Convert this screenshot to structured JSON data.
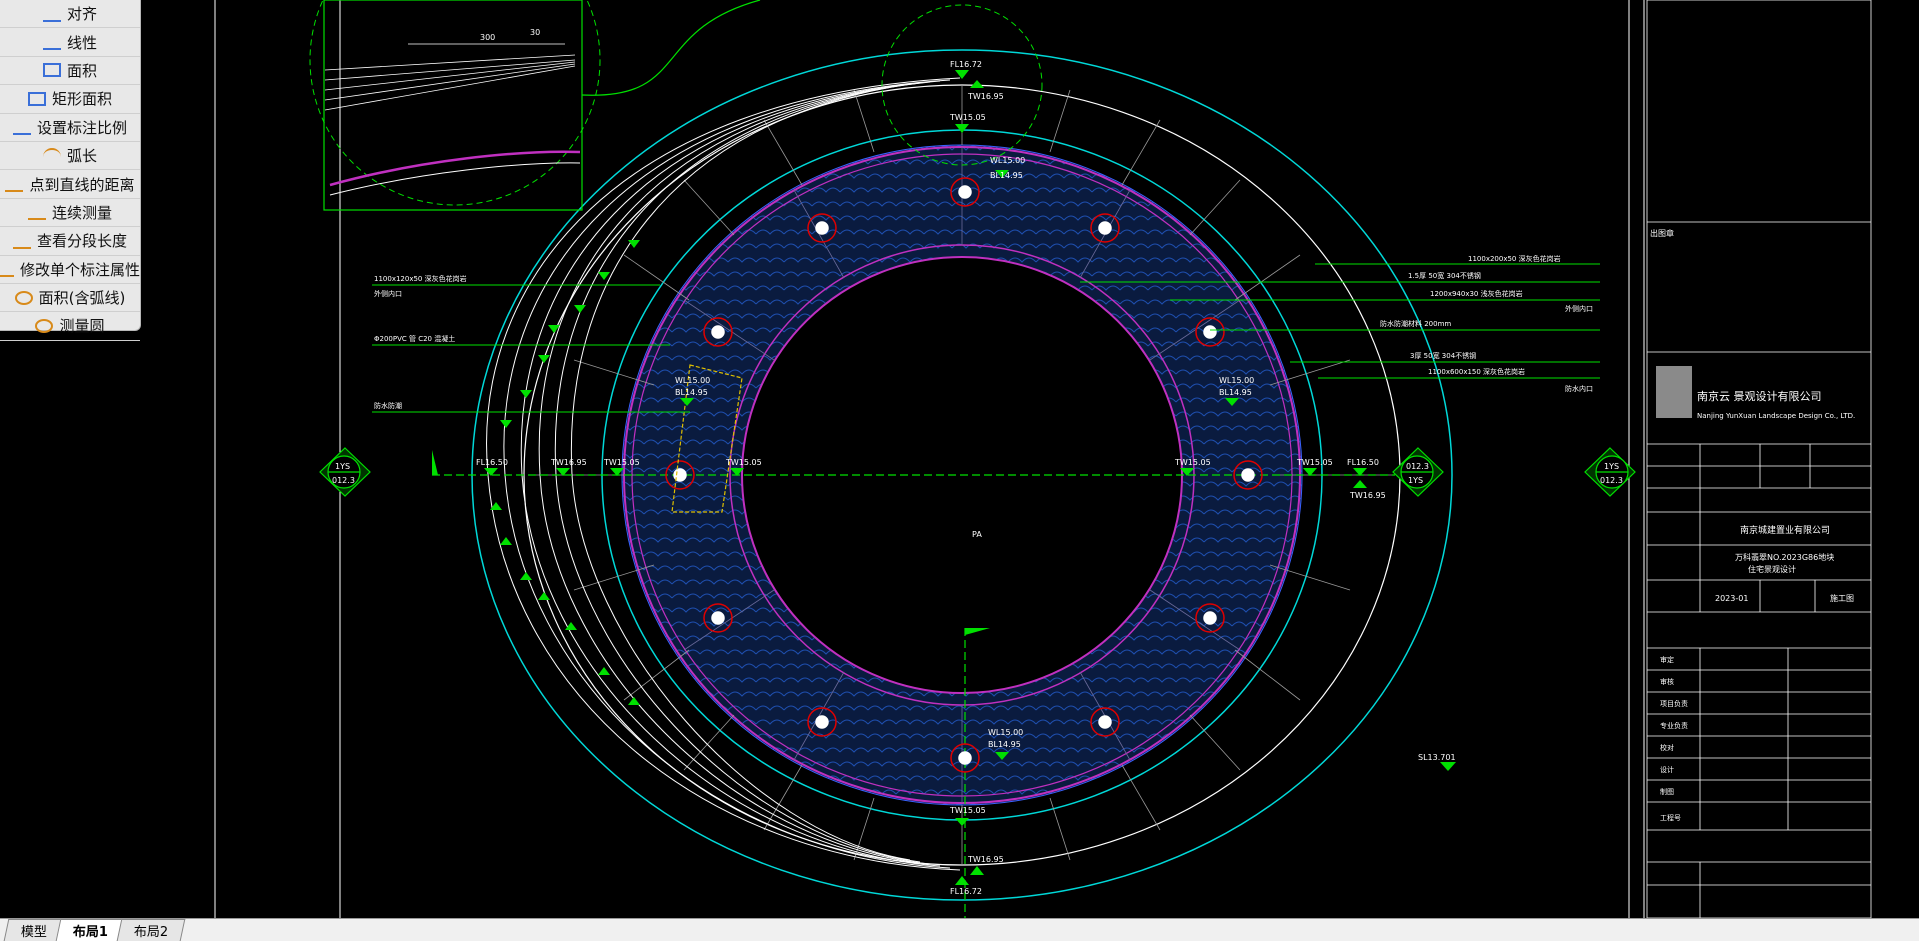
{
  "toolbar": {
    "items": [
      {
        "label": "对齐",
        "icon": "align-icon"
      },
      {
        "label": "线性",
        "icon": "linear-dimension-icon"
      },
      {
        "label": "面积",
        "icon": "area-icon"
      },
      {
        "label": "矩形面积",
        "icon": "rect-area-icon"
      },
      {
        "label": "设置标注比例",
        "icon": "scale-icon"
      },
      {
        "label": "弧长",
        "icon": "arc-length-icon"
      },
      {
        "label": "点到直线的距离",
        "icon": "point-line-distance-icon"
      },
      {
        "label": "连续测量",
        "icon": "continuous-measure-icon"
      },
      {
        "label": "查看分段长度",
        "icon": "segment-length-icon"
      },
      {
        "label": "修改单个标注属性",
        "icon": "edit-annotation-icon"
      },
      {
        "label": "面积(含弧线)",
        "icon": "arc-area-icon"
      },
      {
        "label": "测量圆",
        "icon": "measure-circle-icon"
      }
    ]
  },
  "tabs": [
    {
      "label": "模型",
      "active": false
    },
    {
      "label": "布局1",
      "active": true
    },
    {
      "label": "布局2",
      "active": false
    }
  ],
  "colors": {
    "background": "#000000",
    "cyan": "#00d8d8",
    "magenta": "#c030c0",
    "green": "#00e000",
    "red": "#e00000",
    "water": "#0a1b3f"
  },
  "drawing": {
    "center_label": "PA",
    "detail_dims": [
      "300",
      "30"
    ],
    "elevations": {
      "top1": "FL16.72",
      "top2": "TW16.95",
      "top3": "TW15.05",
      "wl_top": "WL15.00",
      "bl_top": "BL14.95",
      "bottom_wl": "WL15.00",
      "bottom_bl": "BL14.95",
      "bottom1": "TW15.05",
      "bottom2": "TW16.95",
      "bottom3": "FL16.72",
      "left_fl": "FL16.50",
      "left_tw1": "TW16.95",
      "left_tw2": "TW15.05",
      "left_tw3": "TW15.05",
      "left_wl": "WL15.00",
      "left_bl": "BL14.95",
      "right_tw1": "TW15.05",
      "right_tw2": "TW15.05",
      "right_fl": "FL16.50",
      "right_tw3": "TW16.95",
      "right_wl": "WL15.00",
      "right_bl": "BL14.95",
      "sl_right": "SL13.701"
    },
    "left_labels": [
      "1100x120x50 深灰色花岗岩",
      "外侧内口",
      "Φ200PVC 管 C20 混凝土",
      "防水防潮"
    ],
    "right_labels": [
      "1100x200x50 深灰色花岗岩",
      "1.5厚 50宽 304不锈钢",
      "1200x940x30 浅灰色花岗岩",
      "外侧内口",
      "防水防潮材料 200mm",
      "3厚 50宽 304不锈钢",
      "1100x600x150 深灰色花岗岩",
      "防水内口"
    ],
    "markers": {
      "left_top": "1YS",
      "left_bottom": "012.3",
      "right1_top": "012.3",
      "right1_bottom": "1YS",
      "right2_top": "1YS",
      "right2_bottom": "012.3"
    }
  },
  "title_block": {
    "stamp_label": "出图章",
    "company_cn": "南京云 景观设计有限公司",
    "company_en": "Nanjing YunXuan Landscape Design Co., LTD.",
    "client": "南京城建置业有限公司",
    "project": "万科翡翠NO.2023G86地块",
    "project2": "住宅景观设计",
    "date": "2023-01",
    "sheet": "施工图",
    "fields": [
      "审定",
      "审核",
      "项目负责",
      "专业负责",
      "校对",
      "设计",
      "制图",
      "工程号"
    ]
  }
}
